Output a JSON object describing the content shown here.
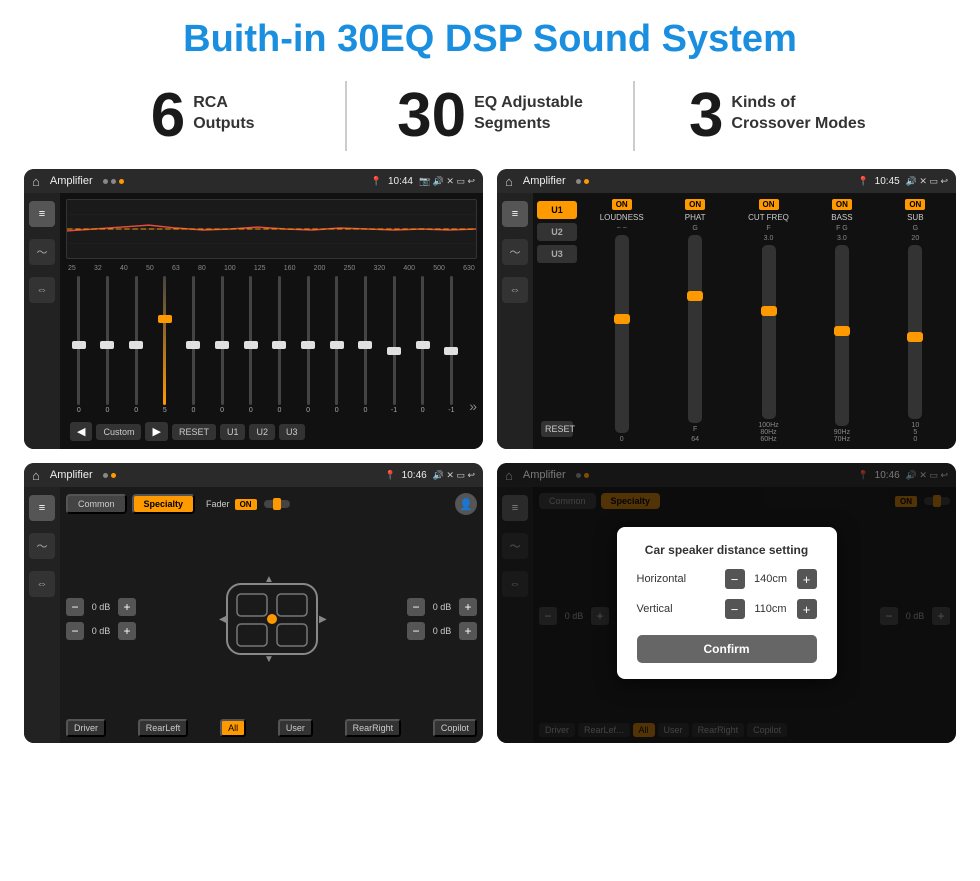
{
  "header": {
    "title": "Buith-in 30EQ DSP Sound System"
  },
  "stats": [
    {
      "number": "6",
      "label_line1": "RCA",
      "label_line2": "Outputs"
    },
    {
      "number": "30",
      "label_line1": "EQ Adjustable",
      "label_line2": "Segments"
    },
    {
      "number": "3",
      "label_line1": "Kinds of",
      "label_line2": "Crossover Modes"
    }
  ],
  "screens": [
    {
      "id": "eq-screen",
      "topbar": {
        "title": "Amplifier",
        "time": "10:44"
      },
      "eq_labels": [
        "25",
        "32",
        "40",
        "50",
        "63",
        "80",
        "100",
        "125",
        "160",
        "200",
        "250",
        "320",
        "400",
        "500",
        "630"
      ],
      "eq_values": [
        "0",
        "0",
        "0",
        "5",
        "0",
        "0",
        "0",
        "0",
        "0",
        "0",
        "0",
        "-1",
        "0",
        "-1"
      ],
      "bottom_buttons": [
        "◀",
        "Custom",
        "▶",
        "RESET",
        "U1",
        "U2",
        "U3"
      ]
    },
    {
      "id": "crossover-screen",
      "topbar": {
        "title": "Amplifier",
        "time": "10:45"
      },
      "presets": [
        "U1",
        "U2",
        "U3"
      ],
      "channels": [
        "LOUDNESS",
        "PHAT",
        "CUT FREQ",
        "BASS",
        "SUB"
      ],
      "reset_label": "RESET"
    },
    {
      "id": "fader-screen",
      "topbar": {
        "title": "Amplifier",
        "time": "10:46"
      },
      "tabs": [
        "Common",
        "Specialty"
      ],
      "fader_label": "Fader",
      "on_label": "ON",
      "db_values": [
        "0 dB",
        "0 dB",
        "0 dB",
        "0 dB"
      ],
      "bottom_buttons": [
        "Driver",
        "RearLeft",
        "All",
        "User",
        "RearRight",
        "Copilot"
      ]
    },
    {
      "id": "fader-dialog-screen",
      "topbar": {
        "title": "Amplifier",
        "time": "10:46"
      },
      "tabs": [
        "Common",
        "Specialty"
      ],
      "on_label": "ON",
      "dialog": {
        "title": "Car speaker distance setting",
        "fields": [
          {
            "label": "Horizontal",
            "value": "140cm"
          },
          {
            "label": "Vertical",
            "value": "110cm"
          }
        ],
        "confirm_label": "Confirm"
      },
      "db_values": [
        "0 dB",
        "0 dB"
      ],
      "bottom_buttons": [
        "Driver",
        "RearLef...",
        "All",
        "User",
        "RearRight",
        "Copilot"
      ]
    }
  ]
}
